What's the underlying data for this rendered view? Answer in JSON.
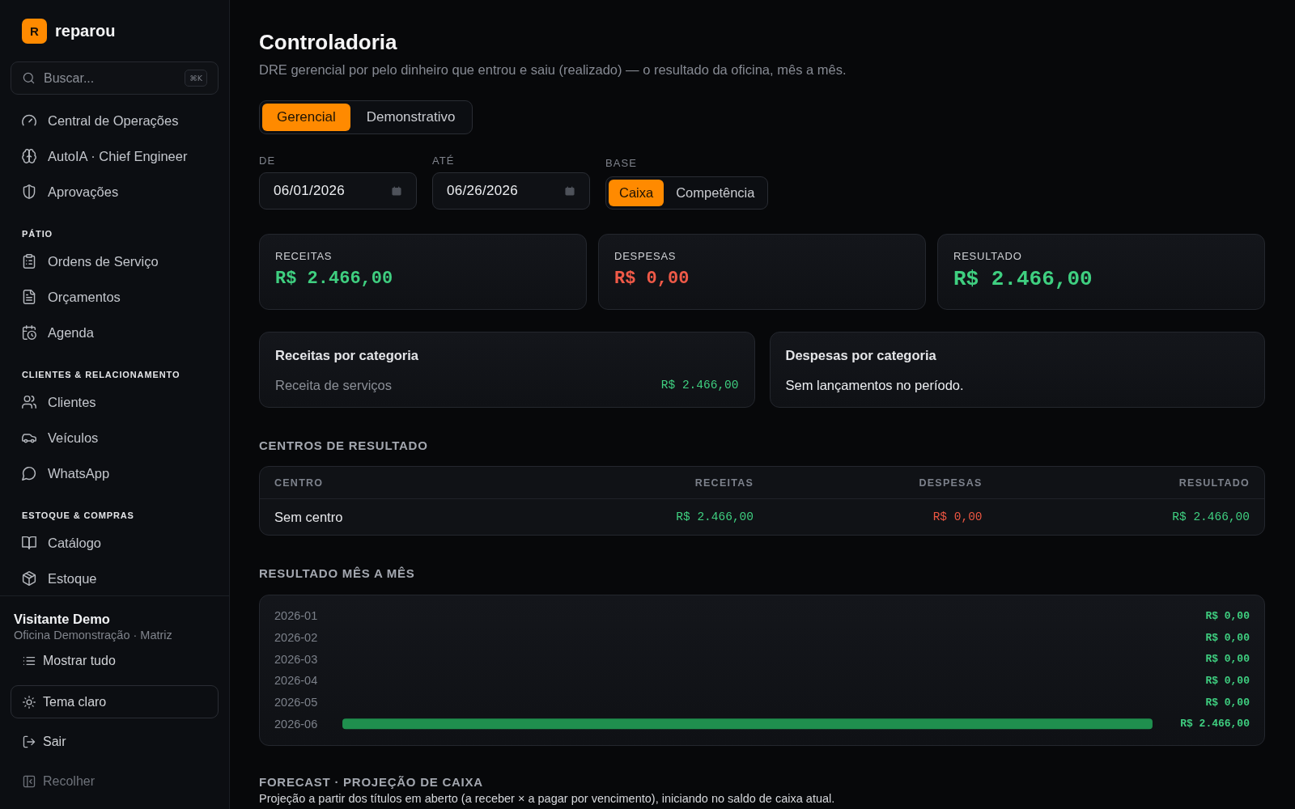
{
  "sidebar": {
    "brand": {
      "mark": "R",
      "name": "reparou"
    },
    "search": {
      "placeholder": "Buscar...",
      "shortcut": "⌘K"
    },
    "nav_groups": [
      {
        "items": [
          {
            "label": "Central de Operações"
          },
          {
            "label": "AutoIA · Chief Engineer"
          },
          {
            "label": "Aprovações"
          }
        ]
      },
      {
        "heading": "PÁTIO",
        "items": [
          {
            "label": "Ordens de Serviço"
          },
          {
            "label": "Orçamentos"
          },
          {
            "label": "Agenda"
          }
        ]
      },
      {
        "heading": "CLIENTES & RELACIONAMENTO",
        "items": [
          {
            "label": "Clientes"
          },
          {
            "label": "Veículos"
          },
          {
            "label": "WhatsApp"
          }
        ]
      },
      {
        "heading": "ESTOQUE & COMPRAS",
        "items": [
          {
            "label": "Catálogo"
          },
          {
            "label": "Estoque"
          }
        ]
      }
    ],
    "user": {
      "name": "Visitante Demo",
      "org": "Oficina Demonstração · Matriz"
    },
    "actions": [
      {
        "label": "Mostrar tudo",
        "kind": "plain"
      },
      {
        "label": "Tema claro",
        "kind": "outlined"
      },
      {
        "label": "Sair",
        "kind": "plain"
      },
      {
        "label": "Recolher",
        "kind": "muted"
      }
    ]
  },
  "page": {
    "title": "Controladoria",
    "subtitle": "DRE gerencial por pelo dinheiro que entrou e saiu (realizado) — o resultado da oficina, mês a mês."
  },
  "view_tabs": [
    {
      "label": "Gerencial",
      "selected": true
    },
    {
      "label": "Demonstrativo",
      "selected": false
    }
  ],
  "filters": {
    "from": {
      "label": "DE",
      "value": "06/01/2026"
    },
    "to": {
      "label": "ATÉ",
      "value": "06/26/2026"
    },
    "base": {
      "label": "BASE",
      "options": [
        {
          "label": "Caixa",
          "selected": true
        },
        {
          "label": "Competência",
          "selected": false
        }
      ]
    }
  },
  "summary": [
    {
      "label": "RECEITAS",
      "value": "R$ 2.466,00",
      "color": "#3fcf80",
      "kind": "metric"
    },
    {
      "label": "DESPESAS",
      "value": "R$ 0,00",
      "color": "#f05a48",
      "kind": "metric"
    },
    {
      "label": "RESULTADO",
      "value": "R$ 2.466,00",
      "color": "#3fcf80",
      "kind": "total"
    }
  ],
  "categories": [
    {
      "title": "Receitas por categoria",
      "rows": [
        {
          "label": "Receita de serviços",
          "amount": "R$ 2.466,00"
        }
      ]
    },
    {
      "title": "Despesas por categoria",
      "empty_message": "Sem lançamentos no período."
    }
  ],
  "centers": {
    "title": "CENTROS DE RESULTADO",
    "columns": [
      "CENTRO",
      "RECEITAS",
      "DESPESAS",
      "RESULTADO"
    ],
    "rows": [
      {
        "cells": [
          "Sem centro",
          "R$ 2.466,00",
          "R$ 0,00",
          "R$ 2.466,00"
        ]
      }
    ]
  },
  "monthly": {
    "title": "RESULTADO MÊS A MÊS",
    "chart_data": {
      "type": "bar",
      "orientation": "horizontal",
      "categories": [
        "2026-01",
        "2026-02",
        "2026-03",
        "2026-04",
        "2026-05",
        "2026-06"
      ],
      "values": [
        0,
        0,
        0,
        0,
        0,
        2466
      ],
      "value_labels": [
        "R$ 0,00",
        "R$ 0,00",
        "R$ 0,00",
        "R$ 0,00",
        "R$ 0,00",
        "R$ 2.466,00"
      ]
    }
  },
  "forecast": {
    "title": "FORECAST · PROJEÇÃO DE CAIXA",
    "description": "Projeção a partir dos títulos em aberto (a receber × a pagar por vencimento), iniciando no saldo de caixa atual."
  }
}
